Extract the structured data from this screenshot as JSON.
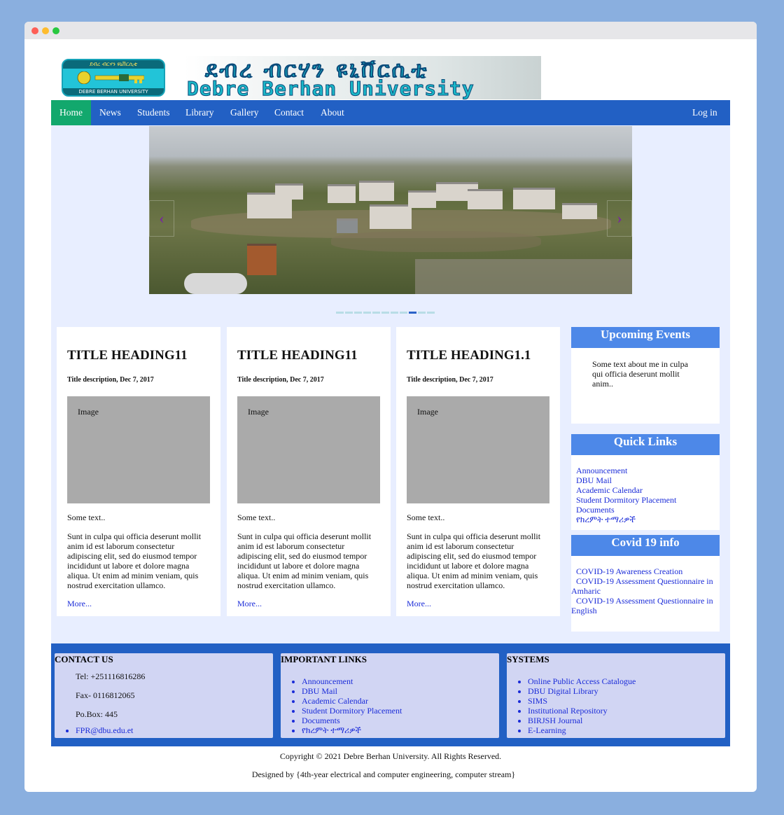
{
  "window": {
    "controls": [
      "close",
      "minimize",
      "maximize"
    ]
  },
  "header": {
    "logo_top_text": "ደብረ ብርሃን ዩኒቨርሲቲ",
    "logo_bottom_text": "DEBRE BERHAN UNIVERSITY",
    "banner_amharic": "ደብረ ብርሃን ዩኒቨርሲቲ",
    "banner_english": "Debre Berhan University"
  },
  "nav": {
    "items": [
      "Home",
      "News",
      "Students",
      "Library",
      "Gallery",
      "Contact",
      "About"
    ],
    "active": "Home",
    "login": "Log in",
    "color": "#2260c4",
    "active_color": "#12a86d"
  },
  "carousel": {
    "prev": "‹",
    "next": "›",
    "indicator_count": 11,
    "active_indicator": 9
  },
  "cards": [
    {
      "title": "TITLE HEADING11",
      "desc": "Title description, Dec 7, 2017",
      "image": "Image",
      "some": "Some text..",
      "body": "Sunt in culpa qui officia deserunt mollit anim id est laborum consectetur adipiscing elit, sed do eiusmod tempor incididunt ut labore et dolore magna aliqua. Ut enim ad minim veniam, quis nostrud exercitation ullamco.",
      "more": "More..."
    },
    {
      "title": "TITLE HEADING11",
      "desc": "Title description, Dec 7, 2017",
      "image": "Image",
      "some": "Some text..",
      "body": "Sunt in culpa qui officia deserunt mollit anim id est laborum consectetur adipiscing elit, sed do eiusmod tempor incididunt ut labore et dolore magna aliqua. Ut enim ad minim veniam, quis nostrud exercitation ullamco.",
      "more": "More..."
    },
    {
      "title": "TITLE HEADING1.1",
      "desc": "Title description, Dec 7, 2017",
      "image": "Image",
      "some": "Some text..",
      "body": "Sunt in culpa qui officia deserunt mollit anim id est laborum consectetur adipiscing elit, sed do eiusmod tempor incididunt ut labore et dolore magna aliqua. Ut enim ad minim veniam, quis nostrud exercitation ullamco.",
      "more": "More..."
    }
  ],
  "sidebar": {
    "events_title": "Upcoming Events",
    "events_text": "Some text about me in culpa qui officia deserunt mollit anim..",
    "quick_title": "Quick Links",
    "quick_links": [
      "Announcement",
      "DBU Mail",
      "Academic Calendar",
      "Student Dormitory Placement",
      "Documents",
      "የክረምት ተማሪዎች"
    ],
    "covid_title": "Covid 19 info",
    "covid_links": [
      "COVID-19 Awareness Creation",
      "COVID-19 Assessment Questionnaire in Amharic",
      "COVID-19 Assessment Questionnaire in English"
    ],
    "header_color": "#4d88e8"
  },
  "footer": {
    "contact_title": "CONTACT US",
    "tel": "Tel: +251116816286",
    "fax": "Fax- 0116812065",
    "pobox": "Po.Box: 445",
    "email": "FPR@dbu.edu.et",
    "links_title": "IMPORTANT LINKS",
    "links": [
      "Announcement",
      "DBU Mail",
      "Academic Calendar",
      "Student Dormitory Placement",
      "Documents",
      "የክረምት ተማሪዎች"
    ],
    "systems_title": "SYSTEMS",
    "systems": [
      "Online Public Access Catalogue",
      "DBU Digital Library",
      "SIMS",
      "Institutional Repository",
      "BIRJSH Journal",
      "E-Learning"
    ],
    "copyright": "Copyright © 2021 Debre Berhan University. All Rights Reserved.",
    "designed": "Designed by {4th-year electrical and computer engineering, computer stream}"
  }
}
